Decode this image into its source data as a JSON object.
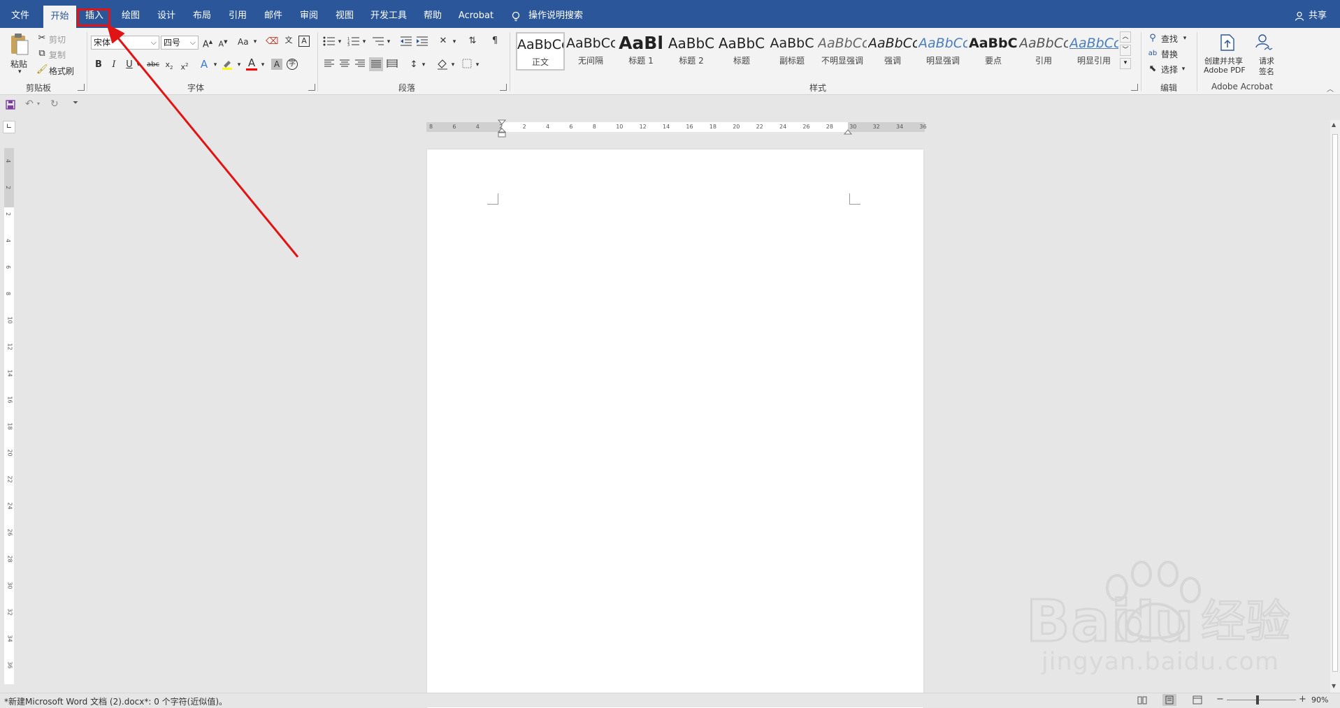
{
  "menu": {
    "file": "文件",
    "home": "开始",
    "insert": "插入",
    "draw": "绘图",
    "design": "设计",
    "layout": "布局",
    "references": "引用",
    "mailings": "邮件",
    "review": "审阅",
    "view": "视图",
    "developer": "开发工具",
    "help": "帮助",
    "acrobat": "Acrobat",
    "tell_me": "操作说明搜索",
    "share": "共享"
  },
  "clipboard": {
    "paste": "粘贴",
    "cut": "剪切",
    "copy": "复制",
    "format_painter": "格式刷",
    "group_label": "剪贴板"
  },
  "font": {
    "font_name": "宋体",
    "font_size": "四号",
    "change_case": "Aa",
    "group_label": "字体"
  },
  "paragraph": {
    "group_label": "段落"
  },
  "styles": {
    "group_label": "样式",
    "items": [
      {
        "sample": "AaBbCcI",
        "name": "正文"
      },
      {
        "sample": "AaBbCcI",
        "name": "无间隔"
      },
      {
        "sample": "AaBl",
        "name": "标题 1"
      },
      {
        "sample": "AaBbC",
        "name": "标题 2"
      },
      {
        "sample": "AaBbC",
        "name": "标题"
      },
      {
        "sample": "AaBbC",
        "name": "副标题"
      },
      {
        "sample": "AaBbCc",
        "name": "不明显强调"
      },
      {
        "sample": "AaBbCc",
        "name": "强调"
      },
      {
        "sample": "AaBbCc",
        "name": "明显强调"
      },
      {
        "sample": "AaBbCi",
        "name": "要点"
      },
      {
        "sample": "AaBbCc",
        "name": "引用"
      },
      {
        "sample": "AaBbCc",
        "name": "明显引用"
      }
    ]
  },
  "editing": {
    "find": "查找",
    "replace": "替换",
    "select": "选择",
    "group_label": "编辑"
  },
  "acrobat_group": {
    "create_share_line1": "创建并共享",
    "create_share_line2": "Adobe PDF",
    "request_line1": "请求",
    "request_line2": "签名",
    "group_label": "Adobe Acrobat"
  },
  "ruler": {
    "horizontal_ticks": [
      "8",
      "6",
      "4",
      "2",
      "2",
      "4",
      "6",
      "8",
      "10",
      "12",
      "14",
      "16",
      "18",
      "20",
      "22",
      "24",
      "26",
      "28",
      "30",
      "32",
      "34",
      "36"
    ],
    "vertical_ticks": [
      "4",
      "2",
      "2",
      "4",
      "6",
      "8",
      "10",
      "12",
      "14",
      "16",
      "18",
      "20",
      "22",
      "24",
      "26",
      "28",
      "30",
      "32",
      "34",
      "36"
    ]
  },
  "status": {
    "doc_info": "*新建Microsoft Word 文档 (2).docx*: 0 个字符(近似值)。",
    "zoom_level": "90%",
    "zoom_minus": "−",
    "zoom_plus": "+"
  },
  "watermark": {
    "brand": "Bai du 经验",
    "url": "jingyan.baidu.com"
  },
  "colors": {
    "title_bar": "#2b579a",
    "highlight_box": "#e01414",
    "arrow": "#e01414",
    "ribbon_bg": "#f3f3f3",
    "canvas_bg": "#e6e6e6",
    "font_color_underline": "#ff0000",
    "highlight_yellow": "#ffff00"
  }
}
